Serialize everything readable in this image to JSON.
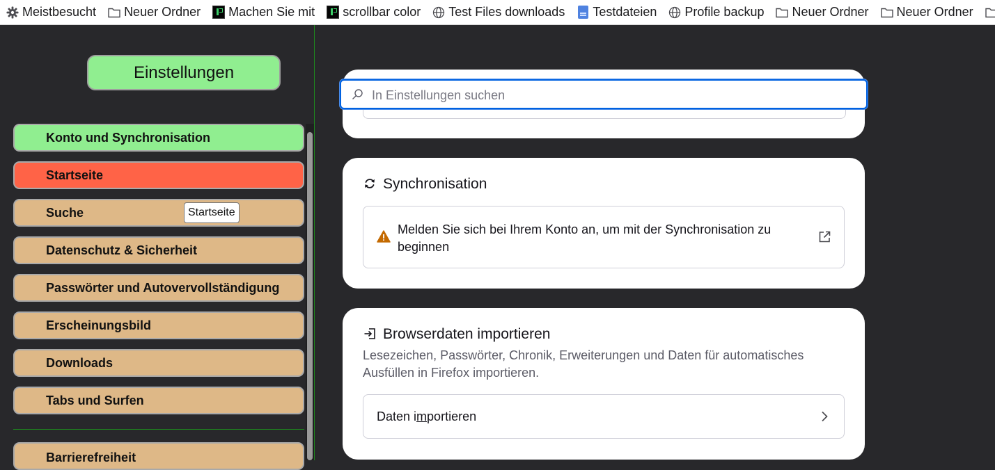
{
  "bookmarks": [
    {
      "label": "Meistbesucht",
      "icon": "gear-icon"
    },
    {
      "label": "Neuer Ordner",
      "icon": "folder-icon"
    },
    {
      "label": "Machen Sie mit",
      "icon": "terminal-icon"
    },
    {
      "label": "scrollbar color",
      "icon": "terminal-icon"
    },
    {
      "label": "Test Files downloads",
      "icon": "globe-icon"
    },
    {
      "label": "Testdateien",
      "icon": "document-icon"
    },
    {
      "label": "Profile backup",
      "icon": "globe-icon"
    },
    {
      "label": "Neuer Ordner",
      "icon": "folder-icon"
    },
    {
      "label": "Neuer Ordner",
      "icon": "folder-icon"
    }
  ],
  "sidebar": {
    "title": "Einstellungen",
    "items": [
      {
        "label": "Konto und Synchronisation"
      },
      {
        "label": "Startseite"
      },
      {
        "label": "Suche"
      },
      {
        "label": "Datenschutz & Sicherheit"
      },
      {
        "label": "Passwörter und Autovervollständigung"
      },
      {
        "label": "Erscheinungsbild"
      },
      {
        "label": "Downloads"
      },
      {
        "label": "Tabs und Surfen"
      },
      {
        "label": "Barrierefreiheit"
      }
    ],
    "tooltip": "Startseite"
  },
  "search": {
    "placeholder": "In Einstellungen suchen"
  },
  "sync": {
    "title": "Synchronisation",
    "message": "Melden Sie sich bei Ihrem Konto an, um mit der Synchronisation zu beginnen"
  },
  "import": {
    "title": "Browserdaten importieren",
    "description": "Lesezeichen, Passwörter, Chronik, Erweiterungen und Daten für automatisches Ausfüllen in Firefox importieren.",
    "button_pre": "Daten i",
    "button_access": "m",
    "button_post": "portieren"
  },
  "colors": {
    "green_item": "#90ee90",
    "red_item": "#ff6347",
    "tan_item": "#deb887",
    "background": "#28282b",
    "focus_ring": "#0061e0"
  }
}
